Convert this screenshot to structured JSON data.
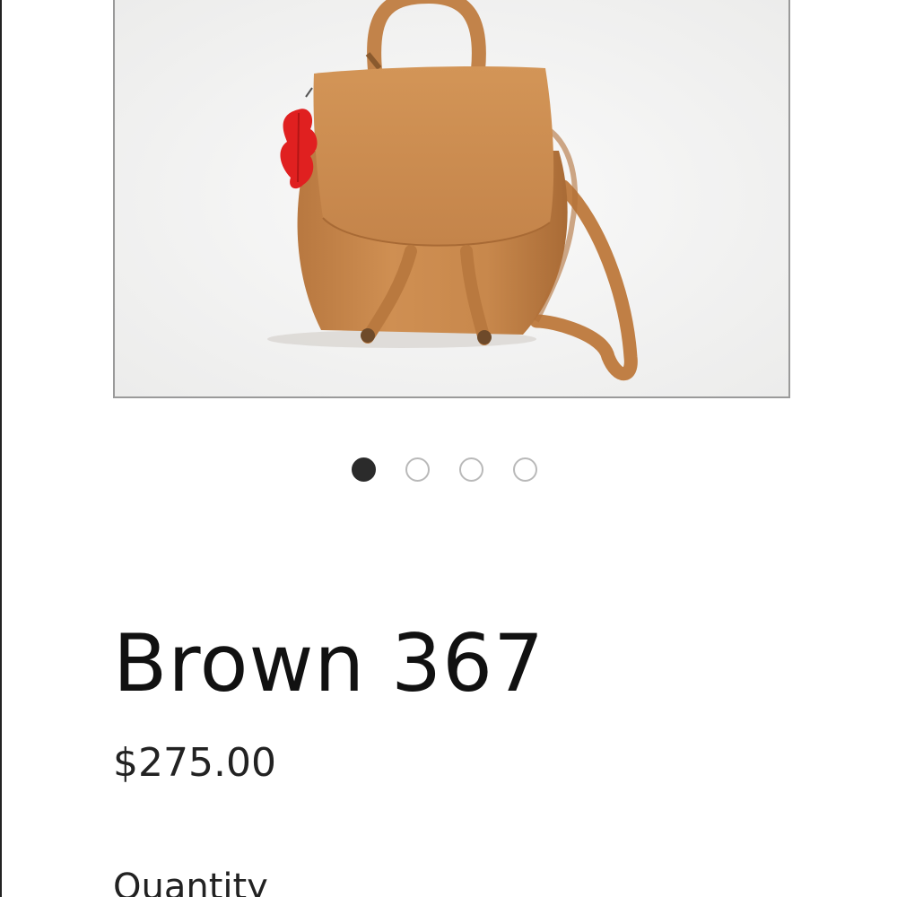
{
  "product": {
    "title": "Brown 367",
    "price": "$275.00",
    "quantity_label": "Quantity"
  },
  "gallery": {
    "image_alt": "Tan leather backpack with red leaf charm",
    "image_count": 4,
    "active_index": 0
  },
  "colors": {
    "leather": "#c98a4f",
    "leather_dark": "#a86a35",
    "charm": "#e02020",
    "active_dot": "#2b2b2b",
    "inactive_dot_border": "#b9b9b9",
    "frame_border": "#9a9a9a"
  }
}
